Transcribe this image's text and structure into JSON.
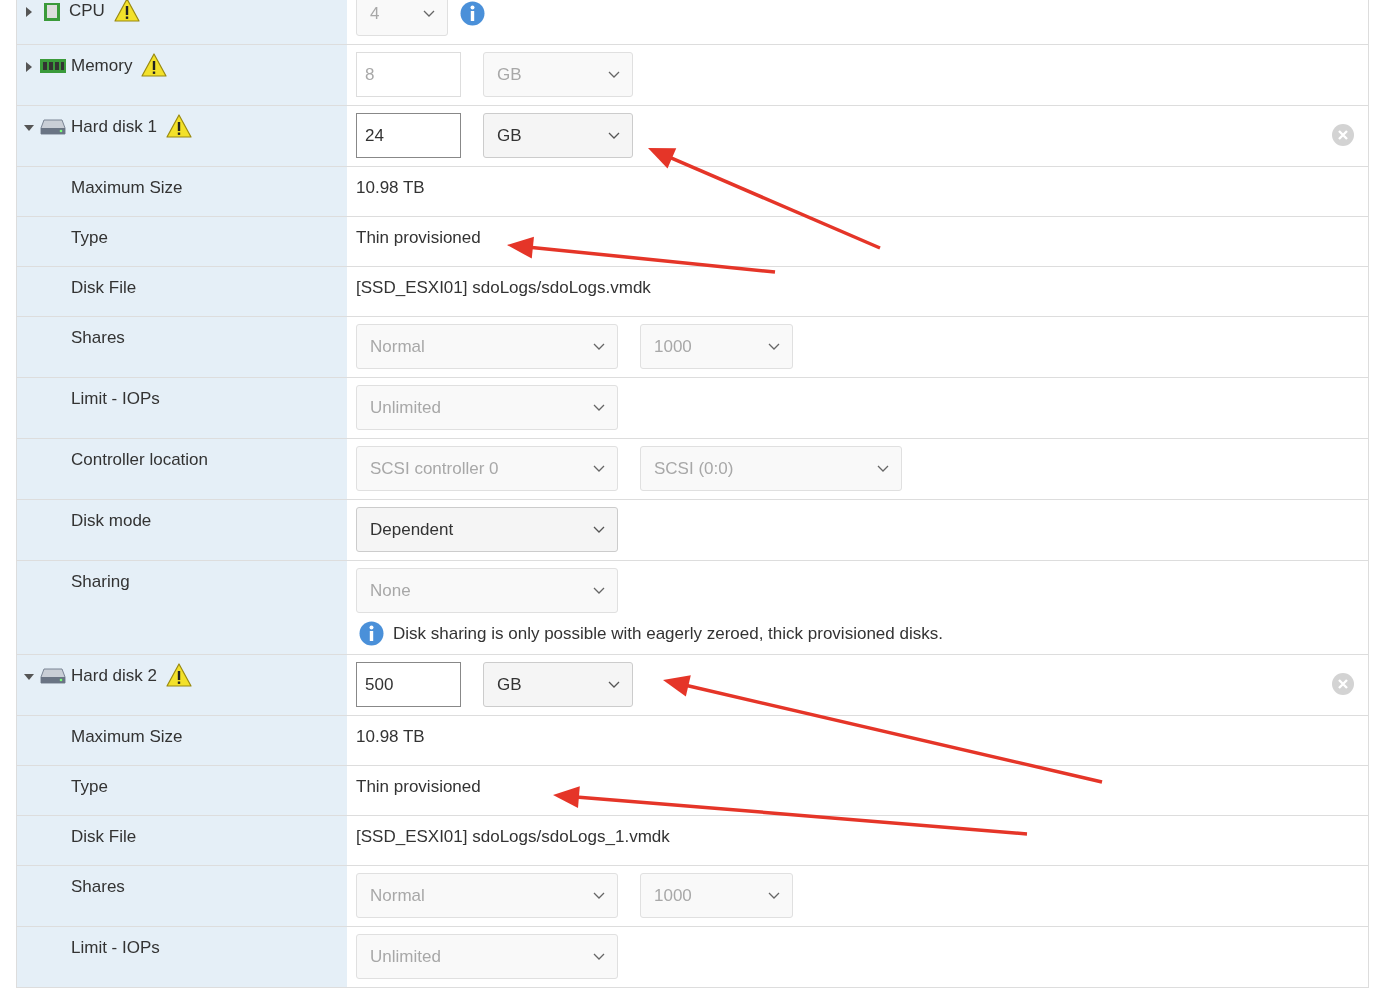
{
  "rows": [
    {
      "kind": "cpu",
      "label": "CPU",
      "expanded": false,
      "warning": true,
      "controls": [
        {
          "kind": "select",
          "value": "4",
          "disabled": true
        },
        {
          "kind": "info"
        }
      ]
    },
    {
      "kind": "memory",
      "label": "Memory",
      "expanded": false,
      "warning": true,
      "controls": [
        {
          "kind": "input",
          "value": "8",
          "disabled": true
        },
        {
          "kind": "select",
          "value": "GB",
          "disabled": true
        }
      ]
    },
    {
      "kind": "disk",
      "label": "Hard disk 1",
      "expanded": true,
      "warning": true,
      "controls": [
        {
          "kind": "input",
          "value": "24",
          "disabled": false
        },
        {
          "kind": "select",
          "value": "GB",
          "disabled": false
        }
      ]
    },
    {
      "kind": "property",
      "label": "Maximum Size",
      "controls": [
        {
          "kind": "text",
          "value": "10.98 TB"
        }
      ]
    },
    {
      "kind": "property",
      "label": "Type",
      "controls": [
        {
          "kind": "text",
          "value": "Thin provisioned"
        }
      ]
    },
    {
      "kind": "property",
      "label": "Disk File",
      "controls": [
        {
          "kind": "text",
          "value": "[SSD_ESXI01] sdoLogs/sdoLogs.vmdk"
        }
      ]
    },
    {
      "kind": "property",
      "label": "Shares",
      "controls": [
        {
          "kind": "select",
          "value": "Normal",
          "disabled": true
        },
        {
          "kind": "select",
          "value": "1000",
          "disabled": true
        }
      ]
    },
    {
      "kind": "property",
      "label": "Limit - IOPs",
      "controls": [
        {
          "kind": "select",
          "value": "Unlimited",
          "disabled": true
        }
      ]
    },
    {
      "kind": "property",
      "label": "Controller location",
      "controls": [
        {
          "kind": "select",
          "value": "SCSI controller 0",
          "disabled": true
        },
        {
          "kind": "select",
          "value": "SCSI (0:0)",
          "disabled": true,
          "wide": true
        }
      ]
    },
    {
      "kind": "property",
      "label": "Disk mode",
      "controls": [
        {
          "kind": "select",
          "value": "Dependent",
          "disabled": false
        }
      ]
    },
    {
      "kind": "property",
      "label": "Sharing",
      "controls": [
        {
          "kind": "select",
          "value": "None",
          "disabled": true
        },
        {
          "kind": "note",
          "value": "Disk sharing is only possible with eagerly zeroed, thick provisioned disks."
        }
      ]
    },
    {
      "kind": "disk",
      "label": "Hard disk 2",
      "expanded": true,
      "warning": true,
      "controls": [
        {
          "kind": "input",
          "value": "500",
          "disabled": false
        },
        {
          "kind": "select",
          "value": "GB",
          "disabled": false
        }
      ]
    },
    {
      "kind": "property",
      "label": "Maximum Size",
      "controls": [
        {
          "kind": "text",
          "value": "10.98 TB"
        }
      ]
    },
    {
      "kind": "property",
      "label": "Type",
      "controls": [
        {
          "kind": "text",
          "value": "Thin provisioned"
        }
      ]
    },
    {
      "kind": "property",
      "label": "Disk File",
      "controls": [
        {
          "kind": "text",
          "value": "[SSD_ESXI01] sdoLogs/sdoLogs_1.vmdk"
        }
      ]
    },
    {
      "kind": "property",
      "label": "Shares",
      "controls": [
        {
          "kind": "select",
          "value": "Normal",
          "disabled": true
        },
        {
          "kind": "select",
          "value": "1000",
          "disabled": true
        }
      ]
    },
    {
      "kind": "property",
      "label": "Limit - IOPs",
      "controls": [
        {
          "kind": "select",
          "value": "Unlimited",
          "disabled": true
        }
      ]
    }
  ]
}
